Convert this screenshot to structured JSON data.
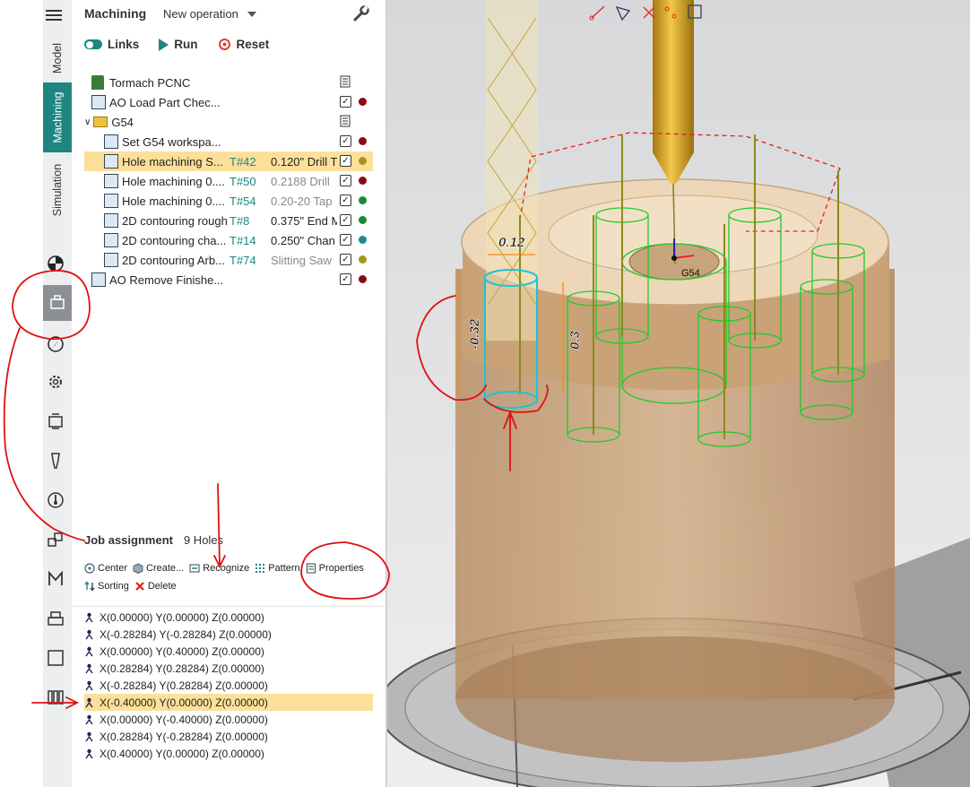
{
  "sidebar": {
    "tabs": [
      {
        "label": "Model",
        "active": false
      },
      {
        "label": "Machining",
        "active": true
      },
      {
        "label": "Simulation",
        "active": false
      }
    ],
    "rail_icons": [
      "appearance-icon",
      "machine-icon",
      "compass-icon",
      "gear-icon",
      "fixture-icon",
      "tool-icon",
      "probe-icon",
      "transform-icon",
      "m-icon",
      "printer-icon",
      "square-icon",
      "library-icon"
    ]
  },
  "panel": {
    "title": "Machining",
    "dropdown": "New operation",
    "toolbar": {
      "links": "Links",
      "run": "Run",
      "reset": "Reset"
    },
    "tree": [
      {
        "name": "Tormach PCNC",
        "tool": "",
        "desc": "",
        "level": 0,
        "kind": "machine",
        "check": false,
        "memo": true,
        "dot": ""
      },
      {
        "name": "AO Load Part Chec...",
        "tool": "",
        "desc": "",
        "level": 0,
        "kind": "op",
        "check": true,
        "memo": false,
        "dot": "#8b0a12"
      },
      {
        "name": "G54",
        "tool": "",
        "desc": "",
        "level": 0,
        "kind": "folder",
        "check": false,
        "memo": true,
        "dot": ""
      },
      {
        "name": "Set G54 workspa...",
        "tool": "",
        "desc": "",
        "level": 1,
        "kind": "op",
        "check": true,
        "memo": false,
        "dot": "#8b0a12"
      },
      {
        "name": "Hole machining S...",
        "tool": "T#42",
        "desc": "0.120\" Drill T",
        "level": 1,
        "kind": "op",
        "check": true,
        "memo": false,
        "dot": "#a3961a",
        "selected": true
      },
      {
        "name": "Hole machining 0....",
        "tool": "T#50",
        "desc": "0.2188 Drill",
        "level": 1,
        "kind": "op",
        "check": true,
        "memo": false,
        "dot": "#8b0a12",
        "gray": true
      },
      {
        "name": "Hole machining 0....",
        "tool": "T#54",
        "desc": "0.20-20 Tap",
        "level": 1,
        "kind": "op",
        "check": true,
        "memo": false,
        "dot": "#1a8a2e",
        "gray": true
      },
      {
        "name": "2D contouring rough",
        "tool": "T#8",
        "desc": "0.375\" End M",
        "level": 1,
        "kind": "op",
        "check": true,
        "memo": false,
        "dot": "#1a8a2e"
      },
      {
        "name": "2D contouring cha...",
        "tool": "T#14",
        "desc": "0.250\" Chan",
        "level": 1,
        "kind": "op",
        "check": true,
        "memo": false,
        "dot": "#1a8a8a"
      },
      {
        "name": "2D contouring Arb...",
        "tool": "T#74",
        "desc": "Slitting Saw",
        "level": 1,
        "kind": "op",
        "check": true,
        "memo": false,
        "dot": "#a3961a",
        "gray": true
      },
      {
        "name": "AO Remove Finishe...",
        "tool": "",
        "desc": "",
        "level": 0,
        "kind": "op",
        "check": true,
        "memo": false,
        "dot": "#8b0a12"
      }
    ],
    "job": {
      "title": "Job assignment",
      "count": "9 Holes",
      "tools": [
        "Center",
        "Create...",
        "Recognize",
        "Pattern",
        "Properties",
        "Sorting",
        "Delete"
      ],
      "points": [
        "X(0.00000) Y(0.00000) Z(0.00000)",
        "X(-0.28284) Y(-0.28284) Z(0.00000)",
        "X(0.00000) Y(0.40000) Z(0.00000)",
        "X(0.28284) Y(0.28284) Z(0.00000)",
        "X(-0.28284) Y(0.28284) Z(0.00000)",
        "X(-0.40000) Y(0.00000) Z(0.00000)",
        "X(0.00000) Y(-0.40000) Z(0.00000)",
        "X(0.28284) Y(-0.28284) Z(0.00000)",
        "X(0.40000) Y(0.00000) Z(0.00000)"
      ],
      "selected_index": 5
    }
  },
  "viewport": {
    "dims": [
      "0.12",
      "-0.32",
      "0.3"
    ],
    "wcs_label": "G54"
  },
  "colors": {
    "accent": "#1e8581",
    "selection": "#fce09a",
    "annotation": "#e01010",
    "toolpath": "#22c22a",
    "stock": "#b78a5e"
  }
}
